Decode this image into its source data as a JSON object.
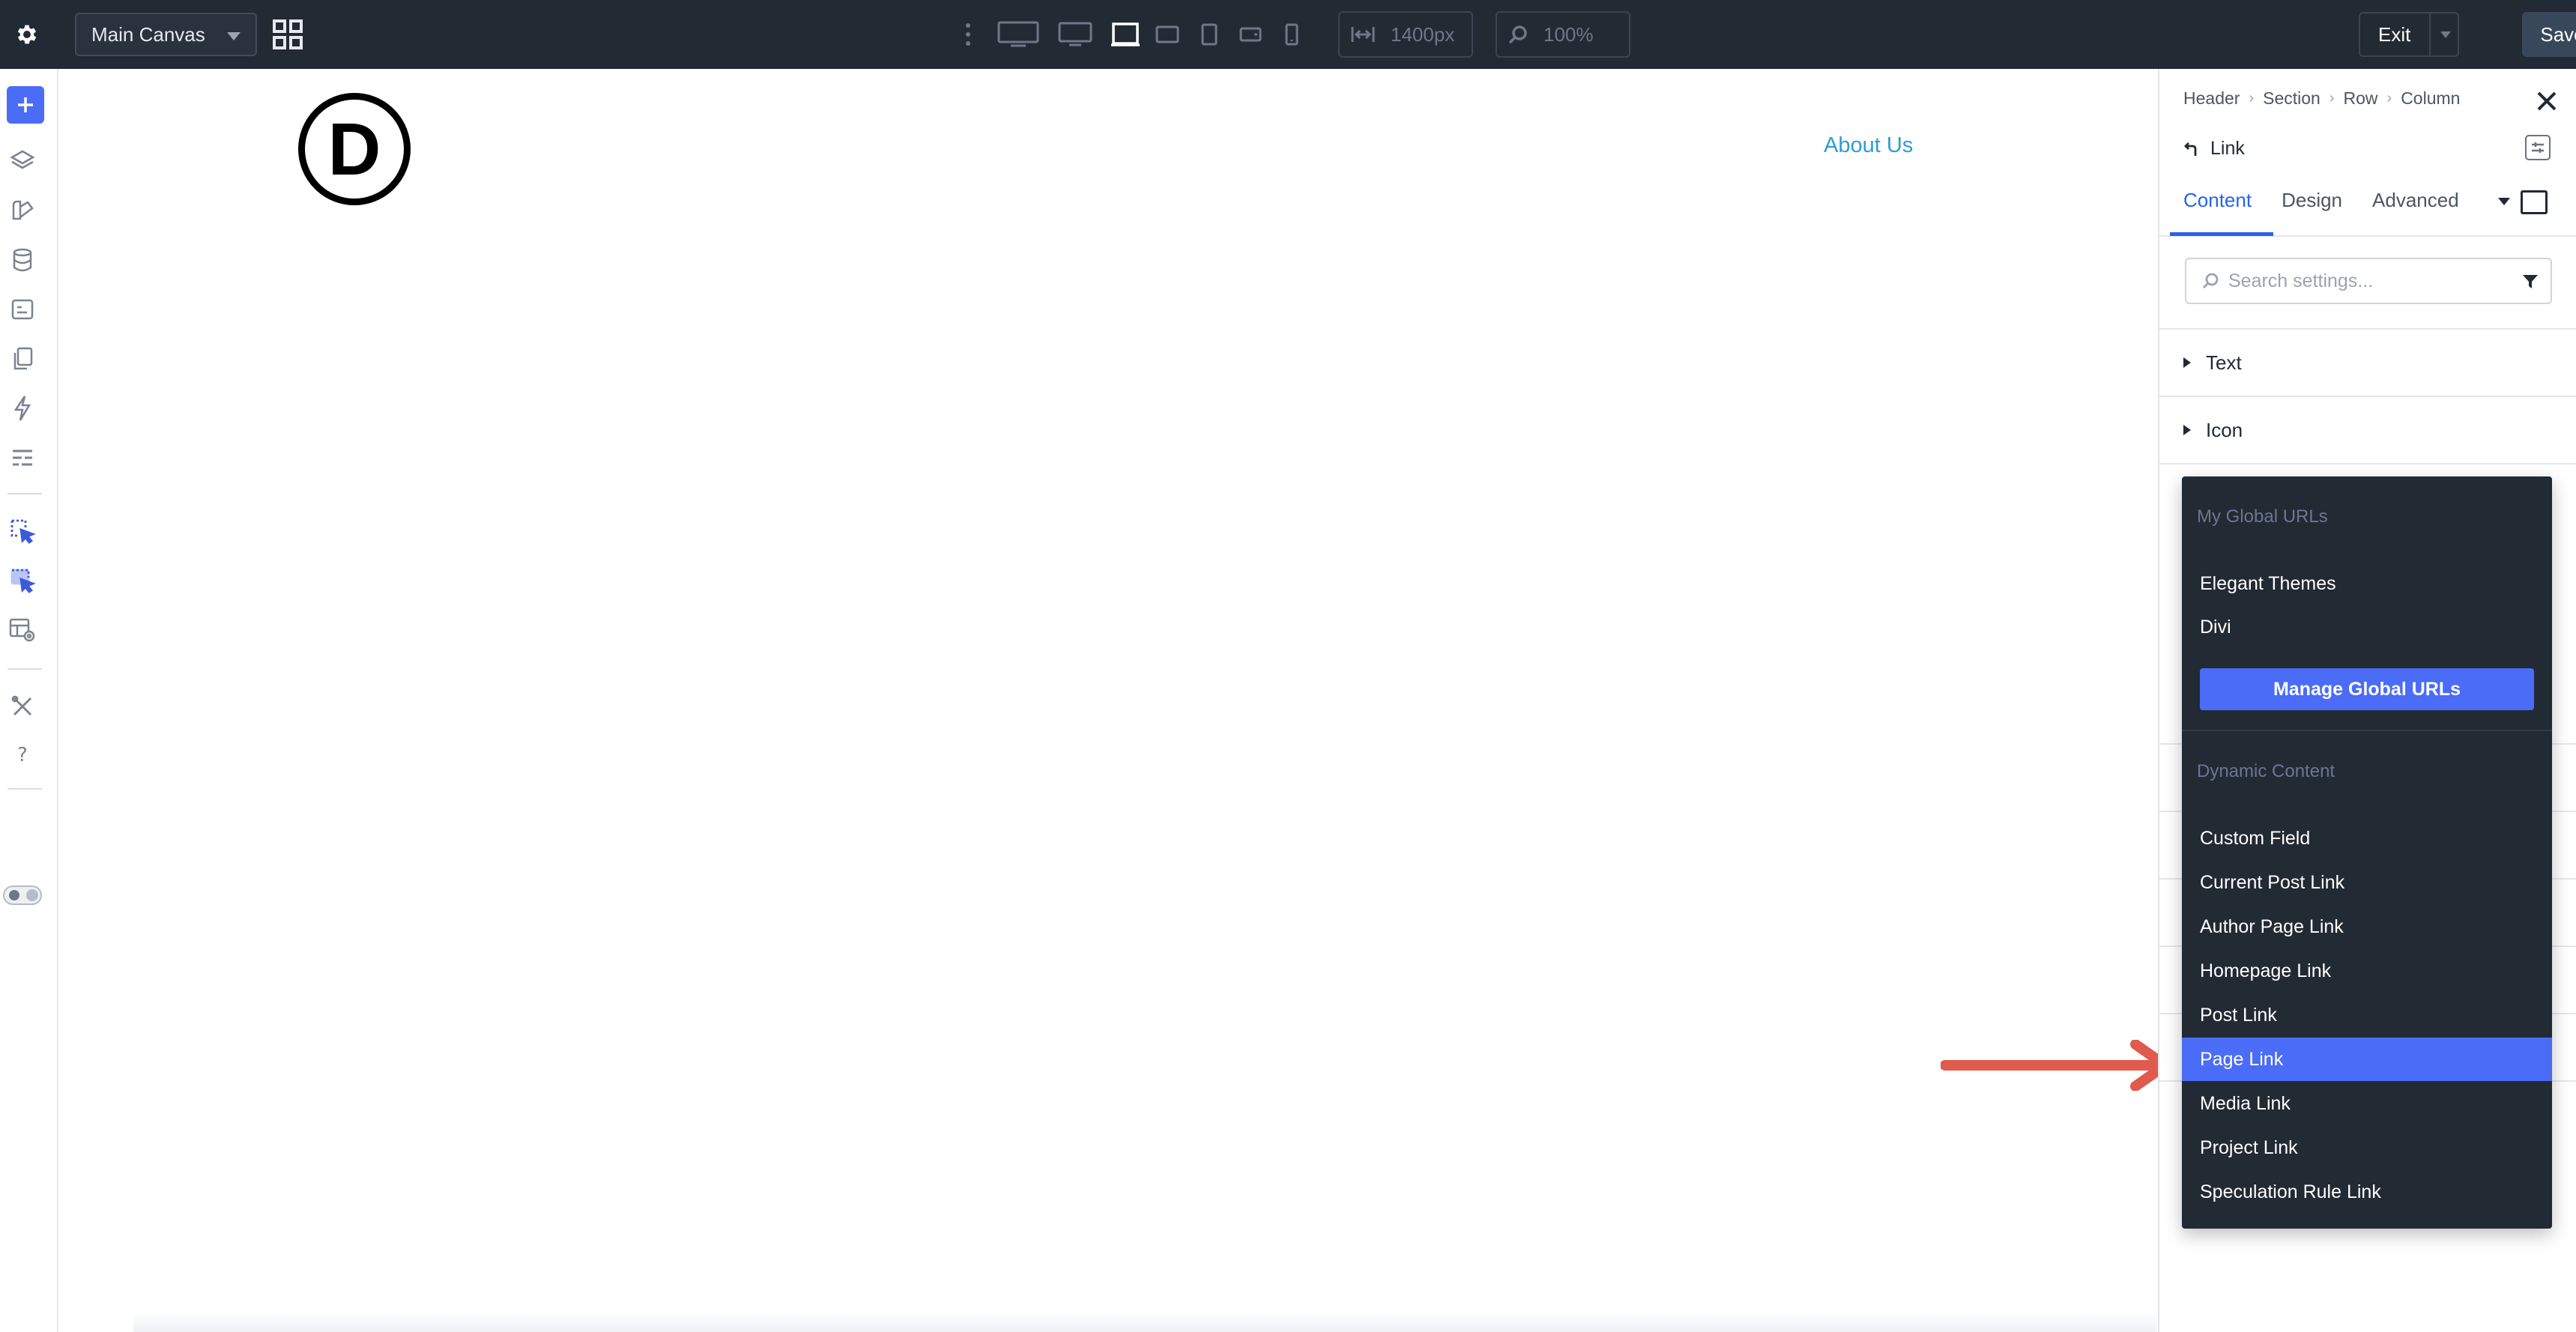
{
  "topbar": {
    "canvas_select": "Main Canvas",
    "width_value": "1400px",
    "zoom_value": "100%",
    "exit_label": "Exit",
    "save_label": "Save"
  },
  "canvas": {
    "logo_letter": "D",
    "nav_link": "About Us"
  },
  "panel": {
    "breadcrumbs": [
      "Header",
      "Section",
      "Row",
      "Column"
    ],
    "module_title": "Link",
    "tabs": [
      "Content",
      "Design",
      "Advanced"
    ],
    "active_tab": "Content",
    "search_placeholder": "Search settings...",
    "sections": [
      "Text",
      "Icon"
    ]
  },
  "dropdown": {
    "global_header": "My Global URLs",
    "global_items": [
      "Elegant Themes",
      "Divi"
    ],
    "manage_button": "Manage Global URLs",
    "dynamic_header": "Dynamic Content",
    "dynamic_items": [
      "Custom Field",
      "Current Post Link",
      "Author Page Link",
      "Homepage Link",
      "Post Link",
      "Page Link",
      "Media Link",
      "Project Link",
      "Speculation Rule Link"
    ],
    "selected_item": "Page Link"
  },
  "colors": {
    "accent": "#4a6cf7",
    "topbar_bg": "#222a34",
    "link_blue": "#2e9bd6",
    "arrow_red": "#e05a4e"
  }
}
